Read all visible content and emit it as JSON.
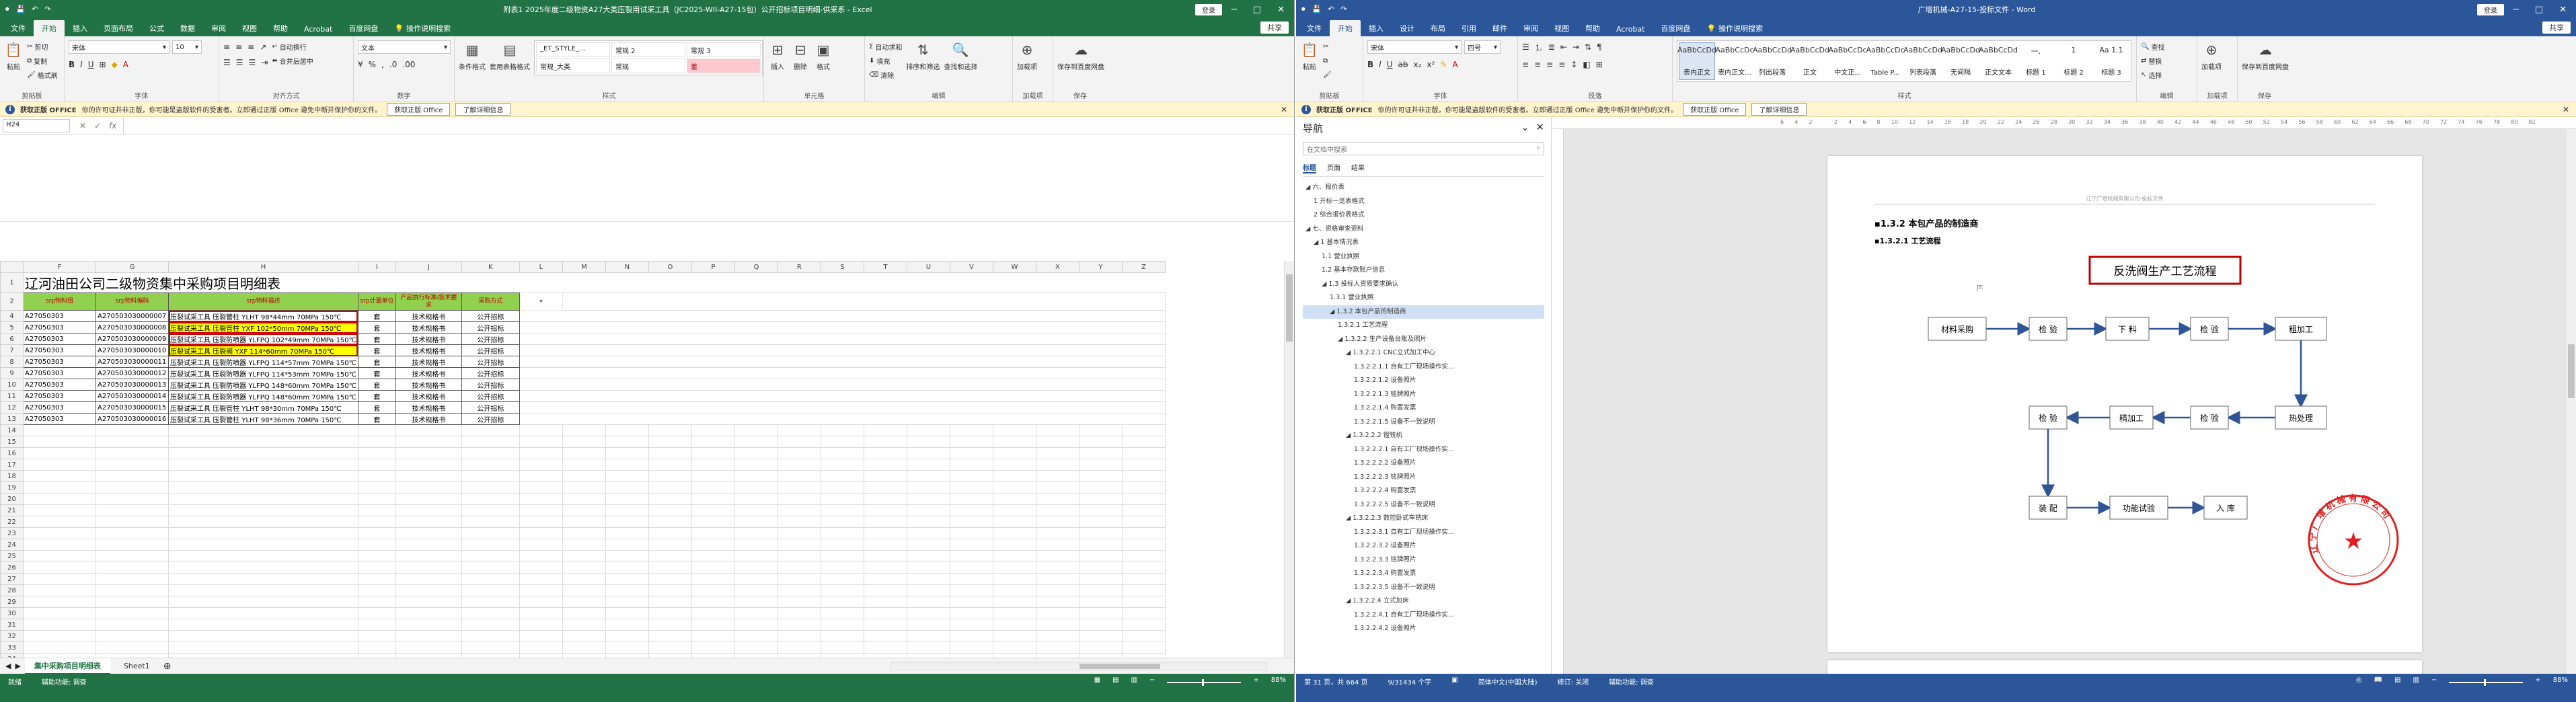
{
  "excel": {
    "titlebar": {
      "title": "附表1 2025年度二级物资A27大类压裂用试采工具（JC2025-WII-A27-15包）公开招标项目明细-供采系 - Excel",
      "account": "登录",
      "min": "─",
      "restore": "□",
      "close": "✕"
    },
    "tabs": [
      "文件",
      "开始",
      "插入",
      "页面布局",
      "公式",
      "数据",
      "审阅",
      "视图",
      "帮助",
      "Acrobat",
      "百度网盘",
      "操作说明搜索"
    ],
    "share": "共享",
    "ribbon": {
      "clipboard": {
        "name": "剪贴板",
        "paste": "粘贴",
        "cut": "剪切",
        "copy": "复制",
        "painter": "格式刷"
      },
      "font": {
        "name": "字体",
        "family": "宋体",
        "size": "10"
      },
      "align": {
        "name": "对齐方式",
        "wrap": "自动换行",
        "merge": "合并后居中"
      },
      "number": {
        "name": "数字",
        "format": "文本"
      },
      "styles": {
        "name": "样式",
        "cond": "条件格式",
        "table": "套用表格格式",
        "cells": [
          "_ET_STYLE_...",
          "常规 2",
          "常规 3",
          "常规_大类",
          "常规",
          "差"
        ]
      },
      "cells": {
        "name": "单元格",
        "insert": "插入",
        "delete": "删除",
        "format": "格式"
      },
      "editing": {
        "name": "编辑",
        "autosum": "自动求和",
        "fill": "填充",
        "clear": "清除",
        "sort": "排序和筛选",
        "find": "查找和选择"
      },
      "addins": {
        "name": "加载项",
        "label": "加载项"
      },
      "save": {
        "name": "保存",
        "label": "保存到百度网盘"
      }
    },
    "message": {
      "title": "获取正版 OFFICE",
      "text": "你的许可证并非正版，你可能是盗版软件的受害者。立即通过正版 Office 避免中断并保护你的文件。",
      "btn1": "获取正版 Office",
      "btn2": "了解详细信息"
    },
    "namebox": "H24",
    "columns": [
      "F",
      "G",
      "H",
      "I",
      "J",
      "K",
      "L",
      "M",
      "N",
      "O",
      "P",
      "Q",
      "R",
      "S",
      "T",
      "U",
      "V",
      "W",
      "X",
      "Y",
      "Z"
    ],
    "sheet_title": "辽河油田公司二级物资集中采购项目明细表",
    "headers": [
      "srp物料组",
      "srp物料编码",
      "srp物料描述",
      "srp计量单位",
      "产品执行标准/技术要求",
      "采购方式"
    ],
    "rows": [
      {
        "n": "4",
        "g": "A27050303",
        "code": "A270503030000007",
        "desc": "压裂试采工具 压裂管柱 YLHT 98*44mm 70MPa 150℃",
        "u": "套",
        "std": "技术规格书",
        "m": "公开招标",
        "hl": false
      },
      {
        "n": "5",
        "g": "A27050303",
        "code": "A270503030000008",
        "desc": "压裂试采工具 压裂管柱 YXF 102*50mm 70MPa 150℃",
        "u": "套",
        "std": "技术规格书",
        "m": "公开招标",
        "hl": true
      },
      {
        "n": "6",
        "g": "A27050303",
        "code": "A270503030000009",
        "desc": "压裂试采工具 压裂防喷器 YLFPQ 102*49mm 70MPa 150℃",
        "u": "套",
        "std": "技术规格书",
        "m": "公开招标",
        "hl": false
      },
      {
        "n": "7",
        "g": "A27050303",
        "code": "A270503030000010",
        "desc": "压裂试采工具 压裂阀 YXF 114*60mm 70MPa 150℃",
        "u": "套",
        "std": "技术规格书",
        "m": "公开招标",
        "hl": true
      },
      {
        "n": "8",
        "g": "A27050303",
        "code": "A270503030000011",
        "desc": "压裂试采工具 压裂防喷器 YLFPQ 114*57mm 70MPa 150℃",
        "u": "套",
        "std": "技术规格书",
        "m": "公开招标",
        "hl": false
      },
      {
        "n": "9",
        "g": "A27050303",
        "code": "A270503030000012",
        "desc": "压裂试采工具 压裂防喷器 YLFPQ 114*53mm 70MPa 150℃",
        "u": "套",
        "std": "技术规格书",
        "m": "公开招标",
        "hl": false
      },
      {
        "n": "10",
        "g": "A27050303",
        "code": "A270503030000013",
        "desc": "压裂试采工具 压裂防喷器 YLFPQ 148*60mm 70MPa 150℃",
        "u": "套",
        "std": "技术规格书",
        "m": "公开招标",
        "hl": false
      },
      {
        "n": "11",
        "g": "A27050303",
        "code": "A270503030000014",
        "desc": "压裂试采工具 压裂防喷器 YLFPQ 148*60mm 70MPa 150℃",
        "u": "套",
        "std": "技术规格书",
        "m": "公开招标",
        "hl": false
      },
      {
        "n": "12",
        "g": "A27050303",
        "code": "A270503030000015",
        "desc": "压裂试采工具 压裂管柱 YLHT 98*30mm 70MPa 150℃",
        "u": "套",
        "std": "技术规格书",
        "m": "公开招标",
        "hl": false
      },
      {
        "n": "13",
        "g": "A27050303",
        "code": "A270503030000016",
        "desc": "压裂试采工具 压裂管柱 YLHT 98*36mm 70MPa 150℃",
        "u": "套",
        "std": "技术规格书",
        "m": "公开招标",
        "hl": false
      }
    ],
    "sheets": [
      "集中采购项目明细表",
      "Sheet1"
    ],
    "status": {
      "ready": "就绪",
      "access": "辅助功能: 调查",
      "zoom": "88%"
    }
  },
  "word": {
    "titlebar": {
      "title": "广增机械-A27-15-投标文件 - Word",
      "account": "登录",
      "min": "─",
      "restore": "□",
      "close": "✕"
    },
    "tabs": [
      "文件",
      "开始",
      "插入",
      "设计",
      "布局",
      "引用",
      "邮件",
      "审阅",
      "视图",
      "帮助",
      "Acrobat",
      "百度网盘",
      "操作说明搜索"
    ],
    "share": "共享",
    "ribbon": {
      "clipboard": {
        "name": "剪贴板",
        "paste": "粘贴"
      },
      "font": {
        "name": "字体",
        "family": "宋体",
        "size": "四号"
      },
      "para": {
        "name": "段落"
      },
      "styles": {
        "name": "样式",
        "items": [
          {
            "pv": "AaBbCcDd",
            "n": "表内正文"
          },
          {
            "pv": "AaBbCcDc",
            "n": "表内正文..."
          },
          {
            "pv": "AaBbCcDd",
            "n": "列出段落"
          },
          {
            "pv": "AaBbCcDd",
            "n": "正文"
          },
          {
            "pv": "AaBbCcDc",
            "n": "中文正..."
          },
          {
            "pv": "AaBbCcDc",
            "n": "Table P..."
          },
          {
            "pv": "AaBbCcDd",
            "n": "列表段落"
          },
          {
            "pv": "AaBbCcDd",
            "n": "无间隔"
          },
          {
            "pv": "AaBbCcDd",
            "n": "正文文本"
          },
          {
            "pv": "一.",
            "n": "标题 1"
          },
          {
            "pv": "1",
            "n": "标题 2"
          },
          {
            "pv": "Aa 1.1",
            "n": "标题 3"
          }
        ]
      },
      "editing": {
        "name": "编辑",
        "find": "查找",
        "replace": "替换",
        "select": "选择"
      },
      "addins": {
        "name": "加载项",
        "label": "加载项"
      },
      "save": {
        "name": "保存",
        "label": "保存到百度网盘"
      }
    },
    "message": {
      "title": "获取正版 OFFICE",
      "text": "你的许可证并非正版，你可能是盗版软件的受害者。立即通过正版 Office 避免中断并保护你的文件。",
      "btn1": "获取正版 Office",
      "btn2": "了解详细信息"
    },
    "nav": {
      "title": "导航",
      "search": "在文档中搜索",
      "tabs": [
        "标题",
        "页面",
        "结果"
      ],
      "items": [
        {
          "t": "◢ 六、报价表",
          "lv": 1
        },
        {
          "t": "1 开标一览表格式",
          "lv": 2
        },
        {
          "t": "2 综合报价表格式",
          "lv": 2
        },
        {
          "t": "◢ 七、资格审查资料",
          "lv": 1
        },
        {
          "t": "◢ 1 基本情况表",
          "lv": 2
        },
        {
          "t": "1.1 营业执照",
          "lv": 3
        },
        {
          "t": "1.2 基本存款账户信息",
          "lv": 3
        },
        {
          "t": "◢ 1.3 投标人资质要求确认",
          "lv": 3
        },
        {
          "t": "1.3.1 营业执照",
          "lv": 4
        },
        {
          "t": "◢ 1.3.2 本包产品的制造商",
          "lv": 4,
          "sel": true
        },
        {
          "t": "1.3.2.1 工艺流程",
          "lv": 5
        },
        {
          "t": "◢ 1.3.2.2 生产设备台账及照片",
          "lv": 5
        },
        {
          "t": "◢ 1.3.2.2.1 CNC立式加工中心",
          "lv": 6
        },
        {
          "t": "1.3.2.2.1.1 自有工厂现场操作实...",
          "lv": 7
        },
        {
          "t": "1.3.2.2.1.2 设备照片",
          "lv": 7
        },
        {
          "t": "1.3.2.2.1.3 铭牌照片",
          "lv": 7
        },
        {
          "t": "1.3.2.2.1.4 购置发票",
          "lv": 7
        },
        {
          "t": "1.3.2.2.1.5 设备不一致说明",
          "lv": 7
        },
        {
          "t": "◢ 1.3.2.2.2 镗铣机",
          "lv": 6
        },
        {
          "t": "1.3.2.2.2.1 自有工厂现场操作实...",
          "lv": 7
        },
        {
          "t": "1.3.2.2.2.2 设备照片",
          "lv": 7
        },
        {
          "t": "1.3.2.2.2.3 铭牌照片",
          "lv": 7
        },
        {
          "t": "1.3.2.2.2.4 购置发票",
          "lv": 7
        },
        {
          "t": "1.3.2.2.2.5 设备不一致说明",
          "lv": 7
        },
        {
          "t": "◢ 1.3.2.2.3 数控卧式车铣床",
          "lv": 6
        },
        {
          "t": "1.3.2.2.3.1 自有工厂现场操作实...",
          "lv": 7
        },
        {
          "t": "1.3.2.2.3.2 设备照片",
          "lv": 7
        },
        {
          "t": "1.3.2.2.3.3 铭牌照片",
          "lv": 7
        },
        {
          "t": "1.3.2.2.3.4 购置发票",
          "lv": 7
        },
        {
          "t": "1.3.2.2.3.5 设备不一致说明",
          "lv": 7
        },
        {
          "t": "◢ 1.3.2.2.4 立式加床",
          "lv": 6
        },
        {
          "t": "1.3.2.2.4.1 自有工厂现场操作实...",
          "lv": 7
        },
        {
          "t": "1.3.2.2.4.2 设备照片",
          "lv": 7
        }
      ]
    },
    "ruler": [
      "6",
      "4",
      "2",
      "",
      "2",
      "4",
      "6",
      "8",
      "10",
      "12",
      "14",
      "16",
      "18",
      "20",
      "22",
      "24",
      "26",
      "28",
      "30",
      "32",
      "34",
      "36",
      "38",
      "40",
      "42",
      "44",
      "46",
      "48",
      "50",
      "52",
      "54",
      "56",
      "58",
      "60",
      "62",
      "64",
      "66",
      "68",
      "70",
      "72",
      "74",
      "76",
      "78",
      "80",
      "82"
    ],
    "doc": {
      "header": "辽宁广增机械有限公司-投标文件",
      "h1": "1.3.2 本包产品的制造商",
      "h2": "1.3.2.1 工艺流程",
      "flow": {
        "title": "反洗阀生产工艺流程",
        "nodes": [
          "材料采购",
          "检 验",
          "下 料",
          "检 验",
          "粗加工",
          "热处理",
          "检 验",
          "精加工",
          "检 验",
          "装 配",
          "功能试验",
          "入 库"
        ],
        "arrow_label": "JE"
      },
      "seal": "辽宁广增机械有限公司"
    },
    "status": {
      "page": "第 31 页，共 664 页",
      "words": "9/31434 个字",
      "lang": "简体中文(中国大陆)",
      "mode": "修订: 关闭",
      "access": "辅助功能: 调查",
      "zoom": "88%"
    }
  }
}
